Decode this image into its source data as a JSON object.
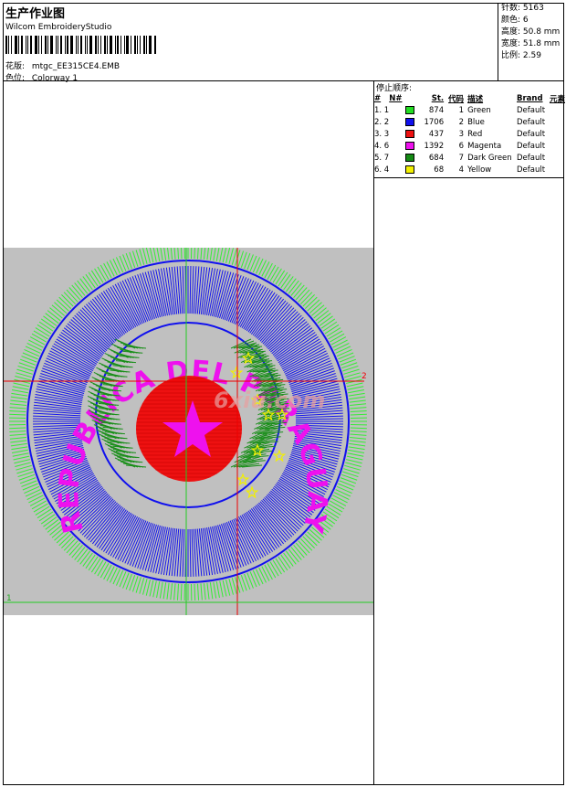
{
  "header": {
    "title": "生产作业图",
    "app_name": "Wilcom EmbroideryStudio",
    "design_label": "花版:",
    "design_value": "mtgc_EE315CE4.EMB",
    "colorway_label": "色位:",
    "colorway_value": "Colorway 1"
  },
  "stats": {
    "stitches": "针数: 5163",
    "colors": "颜色: 6",
    "height": "高度: 50.8 mm",
    "width": "宽度: 51.8 mm",
    "scale": "比例: 2.59"
  },
  "stop_sequence": {
    "title": "停止顺序:",
    "columns": [
      "#",
      "N#",
      "St.",
      "代码",
      "描述",
      "Brand",
      "元素"
    ],
    "rows": [
      {
        "idx": "1. 1",
        "color": "#22dd22",
        "stitches": "874",
        "code": "1",
        "desc": "Green",
        "brand": "Default"
      },
      {
        "idx": "2. 2",
        "color": "#1010ee",
        "stitches": "1706",
        "code": "2",
        "desc": "Blue",
        "brand": "Default"
      },
      {
        "idx": "3. 3",
        "color": "#ee1111",
        "stitches": "437",
        "code": "3",
        "desc": "Red",
        "brand": "Default"
      },
      {
        "idx": "4. 6",
        "color": "#ee11ee",
        "stitches": "1392",
        "code": "6",
        "desc": "Magenta",
        "brand": "Default"
      },
      {
        "idx": "5. 7",
        "color": "#148a14",
        "stitches": "684",
        "code": "7",
        "desc": "Dark Green",
        "brand": "Default"
      },
      {
        "idx": "6. 4",
        "color": "#f2f000",
        "stitches": "68",
        "code": "4",
        "desc": "Yellow",
        "brand": "Default"
      }
    ]
  },
  "canvas": {
    "design_text": "REPUBLICA DEL PARAGUAY",
    "watermark": "6xiu.com",
    "marker_1": "1",
    "marker_2": "2",
    "background": "#c0c0c0"
  }
}
